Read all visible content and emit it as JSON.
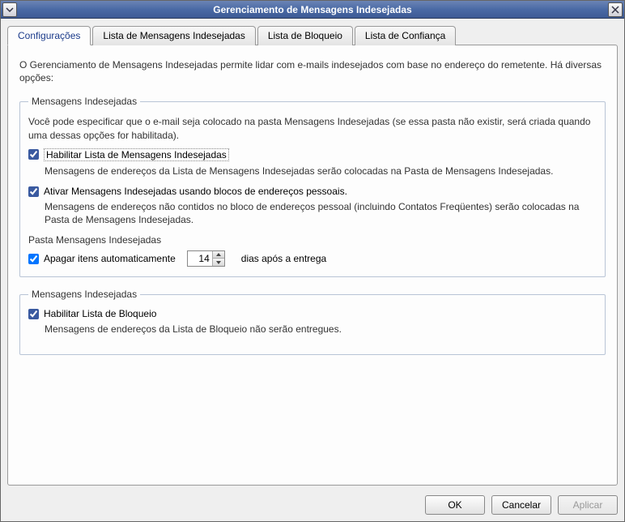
{
  "window": {
    "title": "Gerenciamento de Mensagens Indesejadas"
  },
  "tabs": [
    {
      "label": "Configurações",
      "active": true
    },
    {
      "label": "Lista de Mensagens Indesejadas",
      "active": false
    },
    {
      "label": "Lista de Bloqueio",
      "active": false
    },
    {
      "label": "Lista de Confiança",
      "active": false
    }
  ],
  "intro": "O Gerenciamento de Mensagens Indesejadas permite lidar com e-mails indesejados com base no endereço do remetente. Há diversas opções:",
  "group1": {
    "legend": "Mensagens Indesejadas",
    "desc": "Você pode especificar que o e-mail seja colocado na pasta Mensagens Indesejadas (se essa pasta não existir, será criada quando uma dessas opções for habilitada).",
    "chk1_label": "Habilitar Lista de Mensagens Indesejadas",
    "chk1_checked": true,
    "chk1_sub": "Mensagens de endereços da Lista de Mensagens Indesejadas serão colocadas na Pasta de Mensagens Indesejadas.",
    "chk2_label": "Ativar Mensagens Indesejadas usando blocos de endereços pessoais.",
    "chk2_checked": true,
    "chk2_sub": "Mensagens de endereços não contidos no bloco de endereços pessoal (incluindo Contatos Freqüentes) serão colocadas na Pasta de Mensagens Indesejadas.",
    "folder_label": "Pasta Mensagens Indesejadas",
    "chk3_label": "Apagar itens automaticamente",
    "chk3_checked": true,
    "days_value": "14",
    "days_suffix": "dias após a entrega"
  },
  "group2": {
    "legend": "Mensagens Indesejadas",
    "chk1_label": "Habilitar Lista de Bloqueio",
    "chk1_checked": true,
    "chk1_sub": "Mensagens de endereços da Lista de Bloqueio não serão entregues."
  },
  "buttons": {
    "ok": "OK",
    "cancel": "Cancelar",
    "apply": "Aplicar"
  }
}
